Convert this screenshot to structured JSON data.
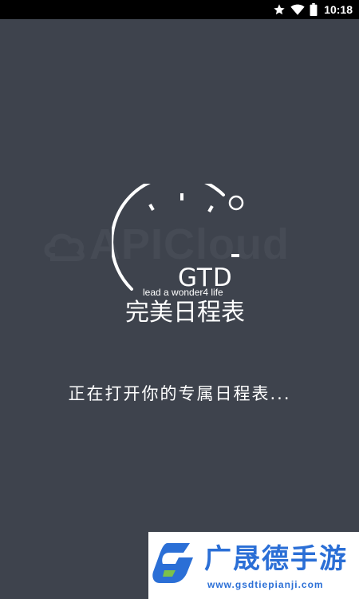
{
  "status_bar": {
    "time": "10:18",
    "icons": [
      "star-icon",
      "wifi-icon",
      "battery-icon"
    ]
  },
  "watermark": {
    "text": "APICloud"
  },
  "logo": {
    "title": "GTD",
    "slogan": "lead a wonder4 life",
    "app_name": "完美日程表"
  },
  "loading": {
    "text": "正在打开你的专属日程表..."
  },
  "brand": {
    "name": "广晟德手游",
    "url": "www.gsdtiepianji.com",
    "color": "#2b6fd6"
  },
  "colors": {
    "background": "#3e434d",
    "text": "#ffffff"
  }
}
